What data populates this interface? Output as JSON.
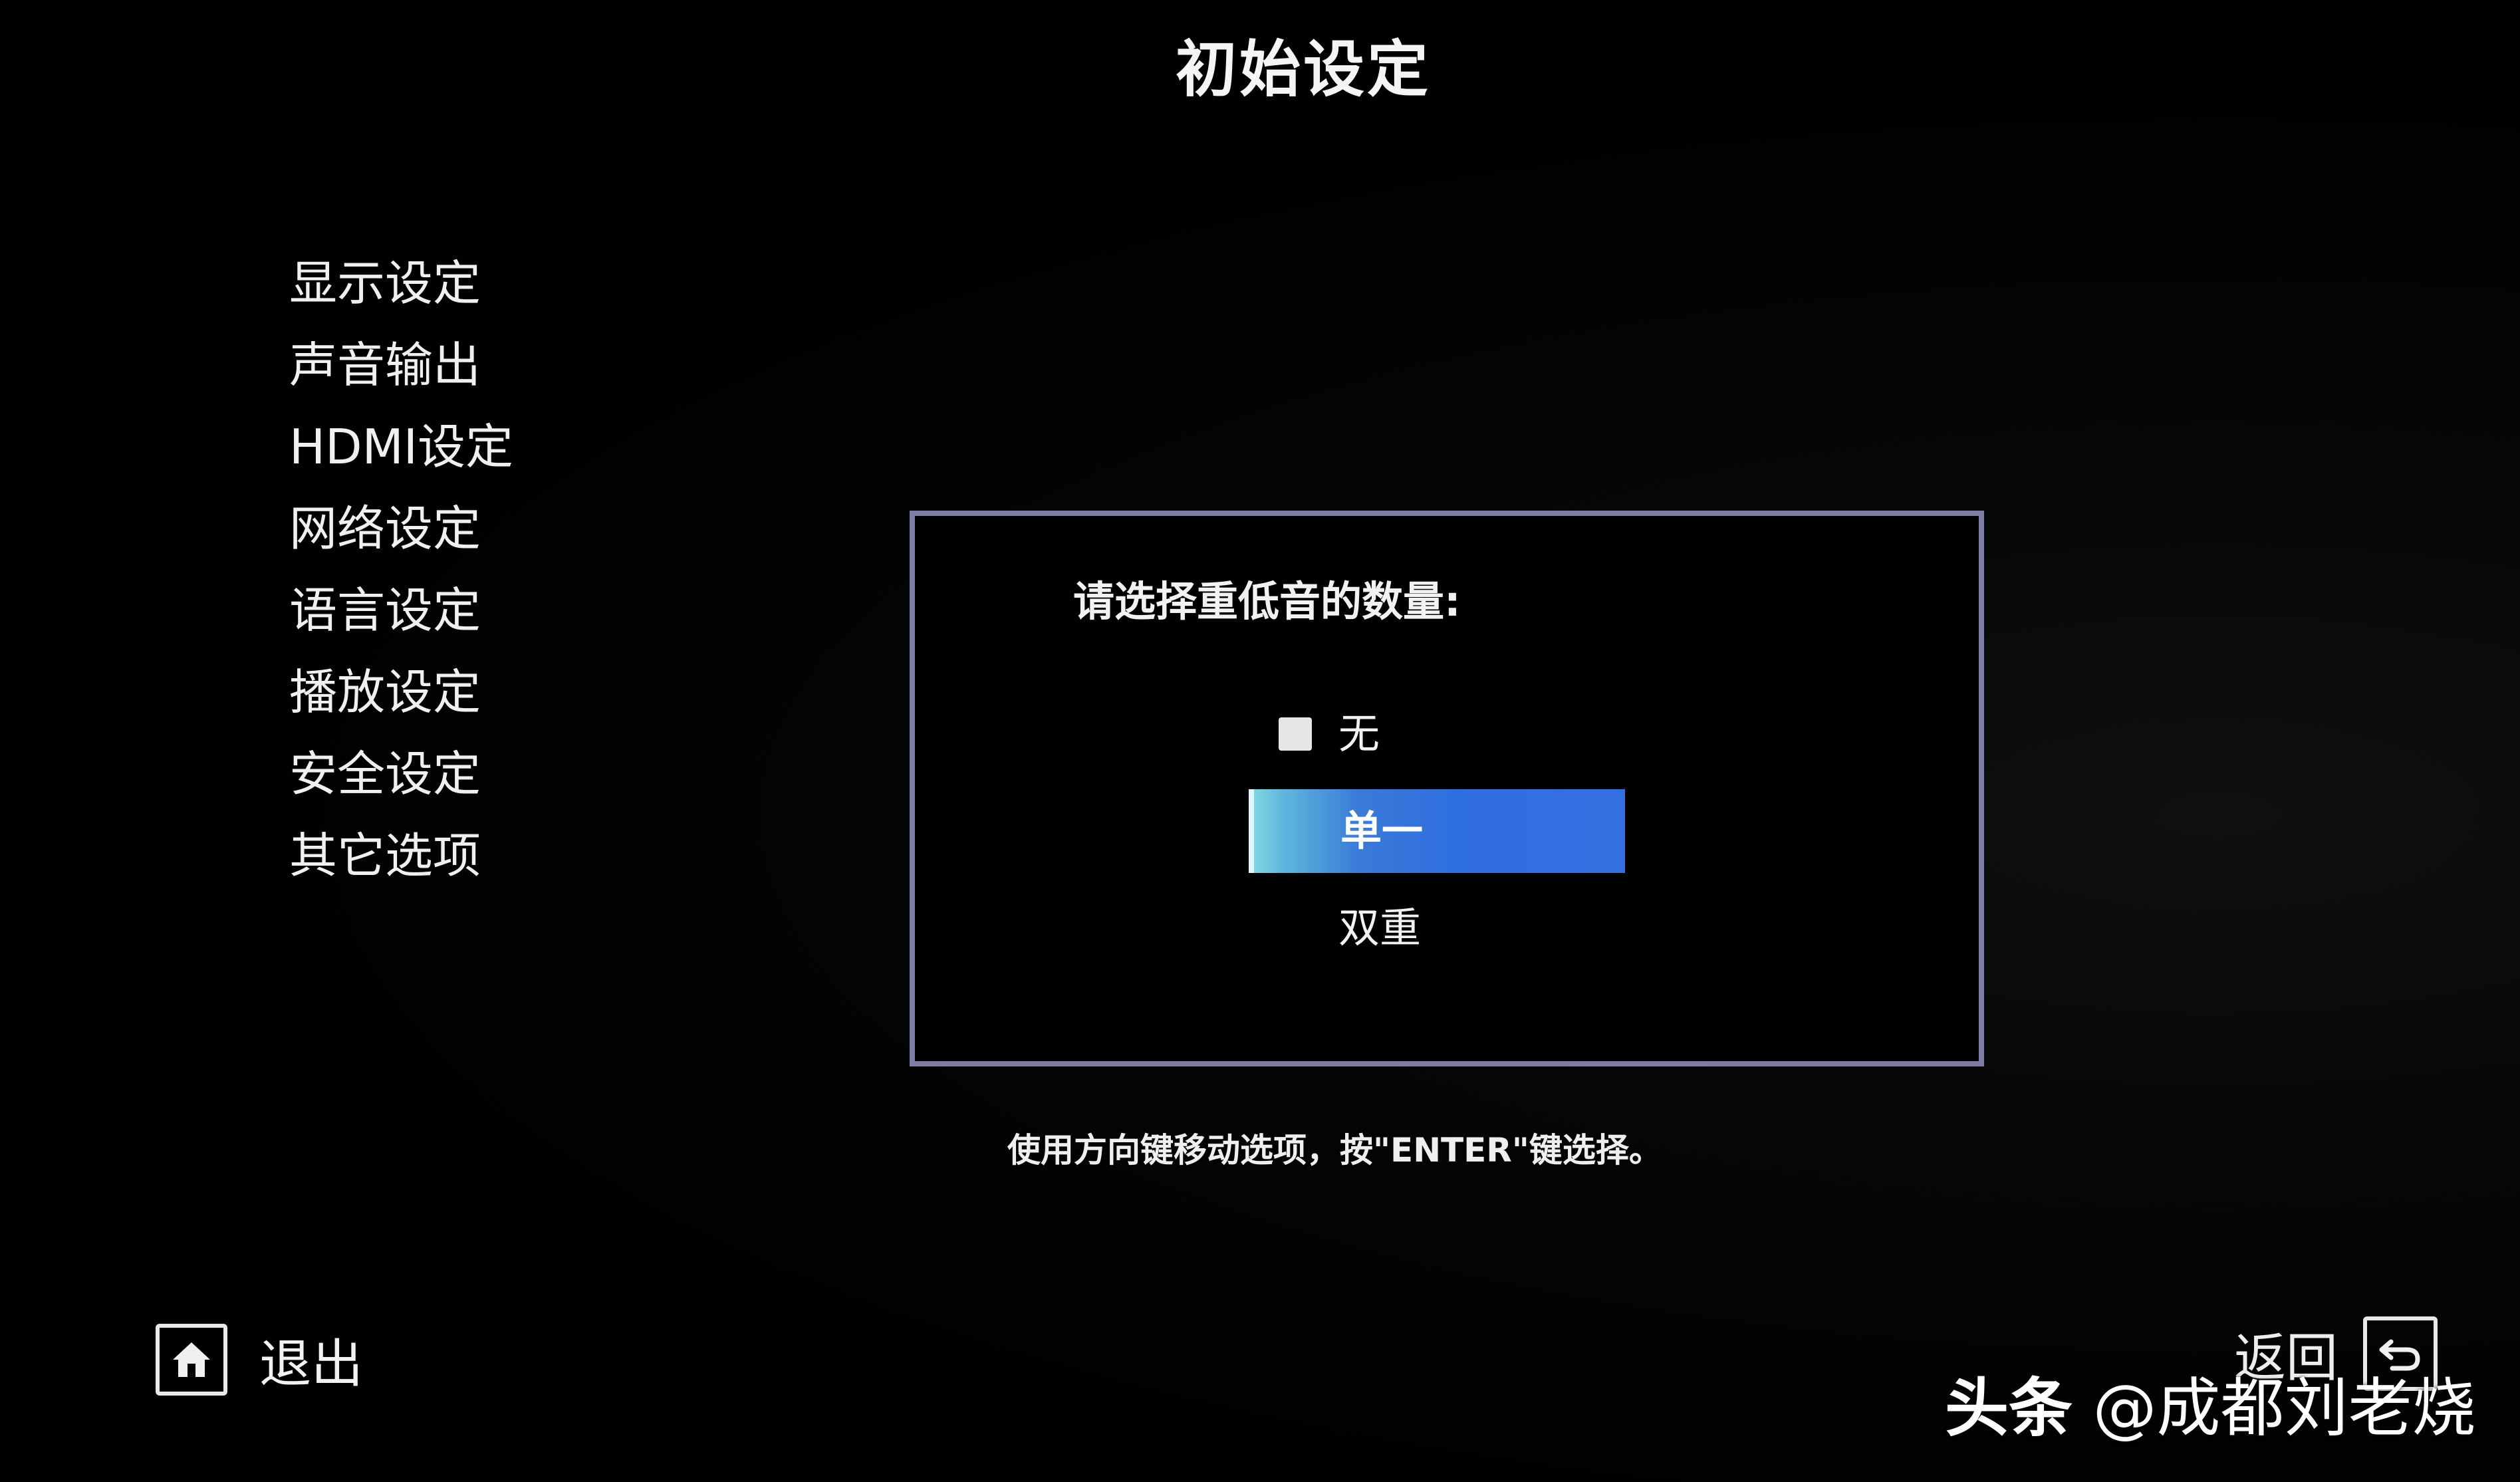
{
  "header": {
    "title": "初始设定"
  },
  "sidebar": {
    "items": [
      {
        "label": "显示设定"
      },
      {
        "label": "声音输出"
      },
      {
        "label": "HDMI设定"
      },
      {
        "label": "网络设定"
      },
      {
        "label": "语言设定"
      },
      {
        "label": "播放设定"
      },
      {
        "label": "安全设定"
      },
      {
        "label": "其它选项"
      }
    ]
  },
  "dialog": {
    "prompt": "请选择重低音的数量:",
    "options": [
      {
        "label": "无",
        "checked": false
      },
      {
        "label": "单一",
        "selected": true
      },
      {
        "label": "双重"
      }
    ]
  },
  "hint": "使用方向键移动选项，按\"ENTER\"键选择。",
  "footer": {
    "exit_label": "退出",
    "exit_icon": "home-icon",
    "back_label": "返回",
    "back_icon": "back-arrow-icon"
  },
  "watermark": {
    "brand": "头条",
    "handle": "@成都刘老烧"
  },
  "colors": {
    "background": "#000000",
    "dialog_border": "#7d7da8",
    "highlight": "#3570e0"
  }
}
